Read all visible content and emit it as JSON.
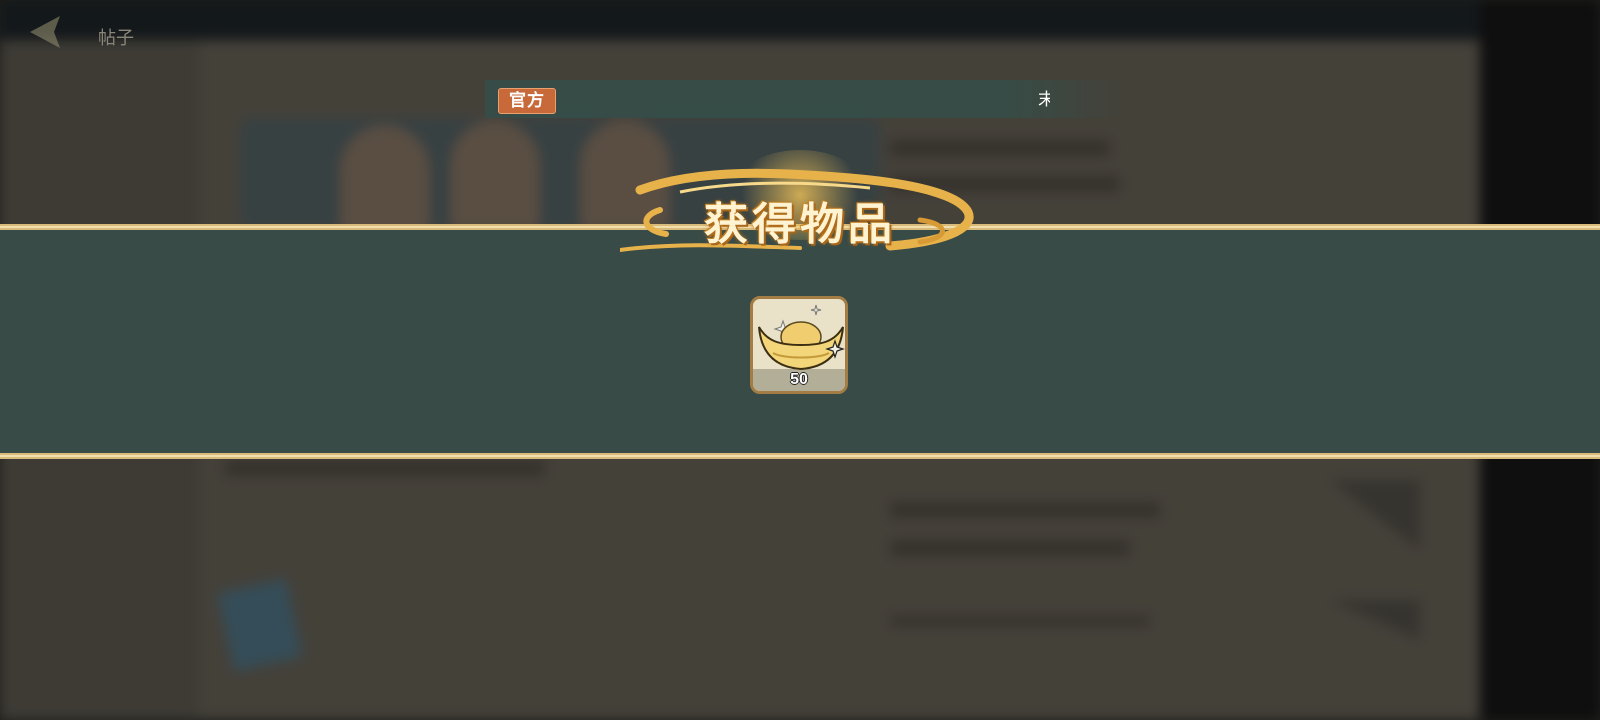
{
  "header": {
    "back_icon": "back-arrow-icon",
    "back_label": "帖子"
  },
  "notice": {
    "tag": "官方",
    "text": "末"
  },
  "reward": {
    "title": "获得物品",
    "item": {
      "icon": "gold-ingot-icon",
      "count": "50"
    }
  },
  "colors": {
    "band": "#384b47",
    "gold_line": "#d8bb7a",
    "tag": "#c8693a",
    "title_fill": "#fff3d2"
  }
}
